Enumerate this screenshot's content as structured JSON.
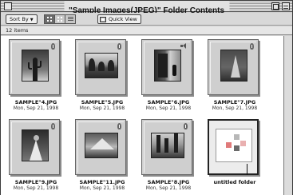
{
  "window": {
    "title": "\"Sample Images(JPEG)\" Folder Contents"
  },
  "toolbar": {
    "sort_label": "Sort By",
    "quick_view_label": "Quick View"
  },
  "status": {
    "item_count": "12 items"
  },
  "items": [
    {
      "name": "SAMPLE\"4.JPG",
      "date": "Mon, Sep 21, 1998",
      "badge": "info-icon"
    },
    {
      "name": "SAMPLE\"5.JPG",
      "date": "Mon, Sep 21, 1998",
      "badge": "info-icon"
    },
    {
      "name": "SAMPLE\"6.JPG",
      "date": "Mon, Sep 21, 1998",
      "badge": "sound-icon"
    },
    {
      "name": "SAMPLE\"7.JPG",
      "date": "Mon, Sep 21, 1998",
      "badge": "info-icon"
    },
    {
      "name": "SAMPLE\"9.JPG",
      "date": "Mon, Sep 21, 1998",
      "badge": "info-icon"
    },
    {
      "name": "SAMPLE\"11.JPG",
      "date": "Mon, Sep 21, 1998",
      "badge": "info-icon"
    },
    {
      "name": "SAMPLE\"8.JPG",
      "date": "Mon, Sep 21, 1998",
      "badge": "info-icon"
    },
    {
      "name": "untitled folder",
      "date": "",
      "badge": "folder-icon"
    }
  ],
  "colors": {
    "window_bg": "#cfcfcf",
    "content_bg": "#ffffff",
    "folder_square_1": "#e07a7a",
    "folder_square_2": "#6a6a6a",
    "folder_square_3": "#b8b8b8"
  }
}
